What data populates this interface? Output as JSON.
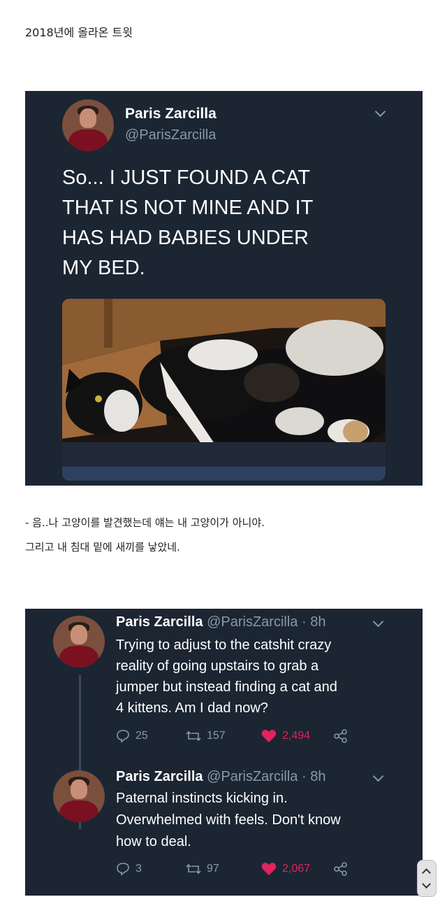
{
  "post_header": "2018년에 올라온 트윗",
  "tweet1": {
    "name": "Paris Zarcilla",
    "handle": "@ParisZarcilla",
    "text_lines": [
      "So... I JUST FOUND A CAT",
      "THAT IS NOT MINE AND IT",
      "HAS HAD BABIES UNDER",
      "MY BED."
    ]
  },
  "caption": {
    "line1": "- 음..나 고양이를 발견했는데 얘는 내 고양이가 아니야.",
    "line2": "그리고 내 침대 밑에 새끼를 낳았네."
  },
  "thread": [
    {
      "name": "Paris Zarcilla",
      "handle": "@ParisZarcilla · 8h",
      "lines": [
        "Trying to adjust to the catshit crazy",
        "reality of going upstairs to grab a",
        "jumper but instead finding a cat and",
        "4 kittens. Am I dad now?"
      ],
      "replies": "25",
      "retweets": "157",
      "likes": "2,494"
    },
    {
      "name": "Paris Zarcilla",
      "handle": "@ParisZarcilla · 8h",
      "lines": [
        "Paternal instincts kicking in.",
        "Overwhelmed with feels. Don't know",
        "how to deal."
      ],
      "replies": "3",
      "retweets": "97",
      "likes": "2,067"
    }
  ],
  "colors": {
    "card_bg": "#1c2532",
    "like": "#e0245e",
    "muted": "#8899a6"
  },
  "icons": [
    "reply-icon",
    "retweet-icon",
    "heart-icon",
    "share-icon",
    "chevron-down-icon"
  ]
}
